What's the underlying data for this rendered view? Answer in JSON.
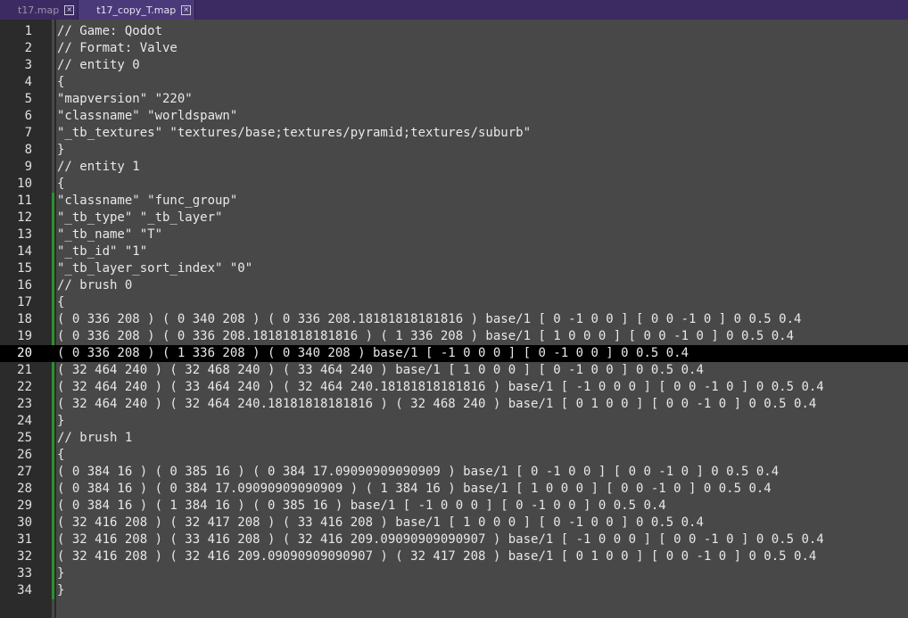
{
  "tabs": [
    {
      "label": "t17.map",
      "close": "×",
      "active": false
    },
    {
      "label": "t17_copy_T.map",
      "close": "×",
      "active": true
    }
  ],
  "editor": {
    "current_line": 20,
    "modified_lines": [
      11,
      34
    ],
    "lines": [
      "// Game: Qodot",
      "// Format: Valve",
      "// entity 0",
      "{",
      "\"mapversion\" \"220\"",
      "\"classname\" \"worldspawn\"",
      "\"_tb_textures\" \"textures/base;textures/pyramid;textures/suburb\"",
      "}",
      "// entity 1",
      "{",
      "\"classname\" \"func_group\"",
      "\"_tb_type\" \"_tb_layer\"",
      "\"_tb_name\" \"T\"",
      "\"_tb_id\" \"1\"",
      "\"_tb_layer_sort_index\" \"0\"",
      "// brush 0",
      "{",
      "( 0 336 208 ) ( 0 340 208 ) ( 0 336 208.18181818181816 ) base/1 [ 0 -1 0 0 ] [ 0 0 -1 0 ] 0 0.5 0.4",
      "( 0 336 208 ) ( 0 336 208.18181818181816 ) ( 1 336 208 ) base/1 [ 1 0 0 0 ] [ 0 0 -1 0 ] 0 0.5 0.4",
      "( 0 336 208 ) ( 1 336 208 ) ( 0 340 208 ) base/1 [ -1 0 0 0 ] [ 0 -1 0 0 ] 0 0.5 0.4",
      "( 32 464 240 ) ( 32 468 240 ) ( 33 464 240 ) base/1 [ 1 0 0 0 ] [ 0 -1 0 0 ] 0 0.5 0.4",
      "( 32 464 240 ) ( 33 464 240 ) ( 32 464 240.18181818181816 ) base/1 [ -1 0 0 0 ] [ 0 0 -1 0 ] 0 0.5 0.4",
      "( 32 464 240 ) ( 32 464 240.18181818181816 ) ( 32 468 240 ) base/1 [ 0 1 0 0 ] [ 0 0 -1 0 ] 0 0.5 0.4",
      "}",
      "// brush 1",
      "{",
      "( 0 384 16 ) ( 0 385 16 ) ( 0 384 17.09090909090909 ) base/1 [ 0 -1 0 0 ] [ 0 0 -1 0 ] 0 0.5 0.4",
      "( 0 384 16 ) ( 0 384 17.09090909090909 ) ( 1 384 16 ) base/1 [ 1 0 0 0 ] [ 0 0 -1 0 ] 0 0.5 0.4",
      "( 0 384 16 ) ( 1 384 16 ) ( 0 385 16 ) base/1 [ -1 0 0 0 ] [ 0 -1 0 0 ] 0 0.5 0.4",
      "( 32 416 208 ) ( 32 417 208 ) ( 33 416 208 ) base/1 [ 1 0 0 0 ] [ 0 -1 0 0 ] 0 0.5 0.4",
      "( 32 416 208 ) ( 33 416 208 ) ( 32 416 209.09090909090907 ) base/1 [ -1 0 0 0 ] [ 0 0 -1 0 ] 0 0.5 0.4",
      "( 32 416 208 ) ( 32 416 209.09090909090907 ) ( 32 417 208 ) base/1 [ 0 1 0 0 ] [ 0 0 -1 0 ] 0 0.5 0.4",
      "}",
      "}"
    ]
  }
}
